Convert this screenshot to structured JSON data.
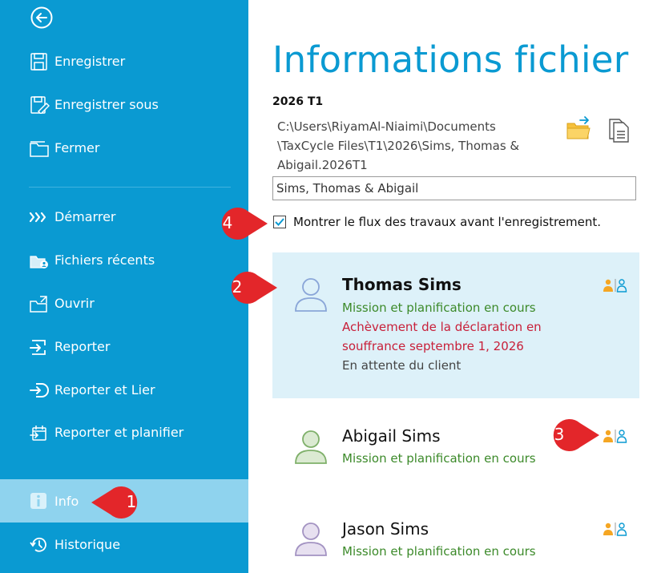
{
  "sidebar": {
    "items": [
      {
        "label": "Enregistrer",
        "icon": "save-icon"
      },
      {
        "label": "Enregistrer sous",
        "icon": "save-as-icon"
      },
      {
        "label": "Fermer",
        "icon": "close-file-icon"
      },
      {
        "label": "Démarrer",
        "icon": "start-icon"
      },
      {
        "label": "Fichiers récents",
        "icon": "recent-files-icon"
      },
      {
        "label": "Ouvrir",
        "icon": "open-icon"
      },
      {
        "label": "Reporter",
        "icon": "carry-forward-icon"
      },
      {
        "label": "Reporter et Lier",
        "icon": "carry-forward-link-icon"
      },
      {
        "label": "Reporter et planifier",
        "icon": "carry-forward-schedule-icon"
      },
      {
        "label": "Info",
        "icon": "info-icon",
        "active": true
      },
      {
        "label": "Historique",
        "icon": "history-icon"
      }
    ]
  },
  "main": {
    "title": "Informations fichier",
    "file_type": "2026 T1",
    "file_path_lines": [
      "C:\\Users\\RiyamAl-Niaimi\\Documents",
      "\\TaxCycle Files\\T1\\2026\\Sims, Thomas &",
      "Abigail.2026T1"
    ],
    "name_field_value": "Sims, Thomas & Abigail",
    "workflow_checkbox": {
      "label": "Montrer le flux des travaux avant l'enregistrement.",
      "checked": true
    }
  },
  "persons": [
    {
      "name": "Thomas Sims",
      "status_lines": [
        {
          "text": "Mission et planification en cours",
          "tone": "green"
        },
        {
          "text": "Achèvement de la déclaration en",
          "tone": "red"
        },
        {
          "text": "souffrance  septembre 1, 2026",
          "tone": "red"
        },
        {
          "text": "En attente du client",
          "tone": "gray"
        }
      ]
    },
    {
      "name": "Abigail Sims",
      "status_lines": [
        {
          "text": "Mission et planification en cours",
          "tone": "green"
        }
      ]
    },
    {
      "name": "Jason Sims",
      "status_lines": [
        {
          "text": "Mission et planification en cours",
          "tone": "green"
        }
      ]
    }
  ],
  "callouts": [
    "1",
    "2",
    "3",
    "4"
  ],
  "colors": {
    "sidebar": "#0a9ad2",
    "sidebar_active": "#8fd3ee",
    "title": "#0a9ad2",
    "selected_card": "#ddf1f9",
    "status_green": "#3c8a2a",
    "status_red": "#c8203a",
    "callout": "#e3262a"
  }
}
